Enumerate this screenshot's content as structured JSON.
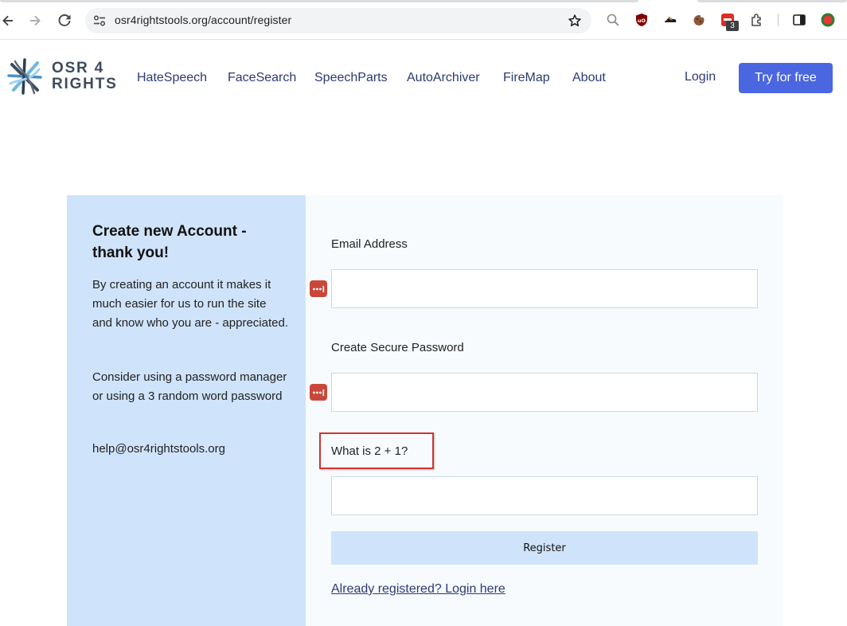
{
  "browser": {
    "url": "osr4rightstools.org/account/register",
    "extension_badge": "3"
  },
  "header": {
    "brand_line1": "OSR 4",
    "brand_line2": "RIGHTS",
    "nav": [
      "HateSpeech",
      "FaceSearch",
      "SpeechParts",
      "AutoArchiver",
      "FireMap",
      "About"
    ],
    "login_label": "Login",
    "try_label": "Try for free",
    "try_color": "#4a66e0"
  },
  "sidebar": {
    "title": "Create new Account - thank you!",
    "para1": "By creating an account it makes it much easier for us to run the site and know who you are - appreciated.",
    "para2": "Consider using a password manager or using a 3 random word password",
    "email": "help@osr4rightstools.org"
  },
  "form": {
    "email_label": "Email Address",
    "email_value": "",
    "password_label": "Create Secure Password",
    "password_value": "",
    "captcha_label": "What is 2 + 1?",
    "captcha_value": "",
    "register_label": "Register",
    "login_link": "Already registered? Login here"
  },
  "icons": {
    "back": "arrow-left-icon",
    "forward": "arrow-right-icon",
    "reload": "reload-icon",
    "site_info": "tune-icon",
    "bookmark": "star-icon",
    "password_manager": "password-manager-icon"
  },
  "colors": {
    "sidebar_bg": "#cfe4fb",
    "card_bg": "#f8fbfd",
    "highlight_box": "#d03434"
  }
}
